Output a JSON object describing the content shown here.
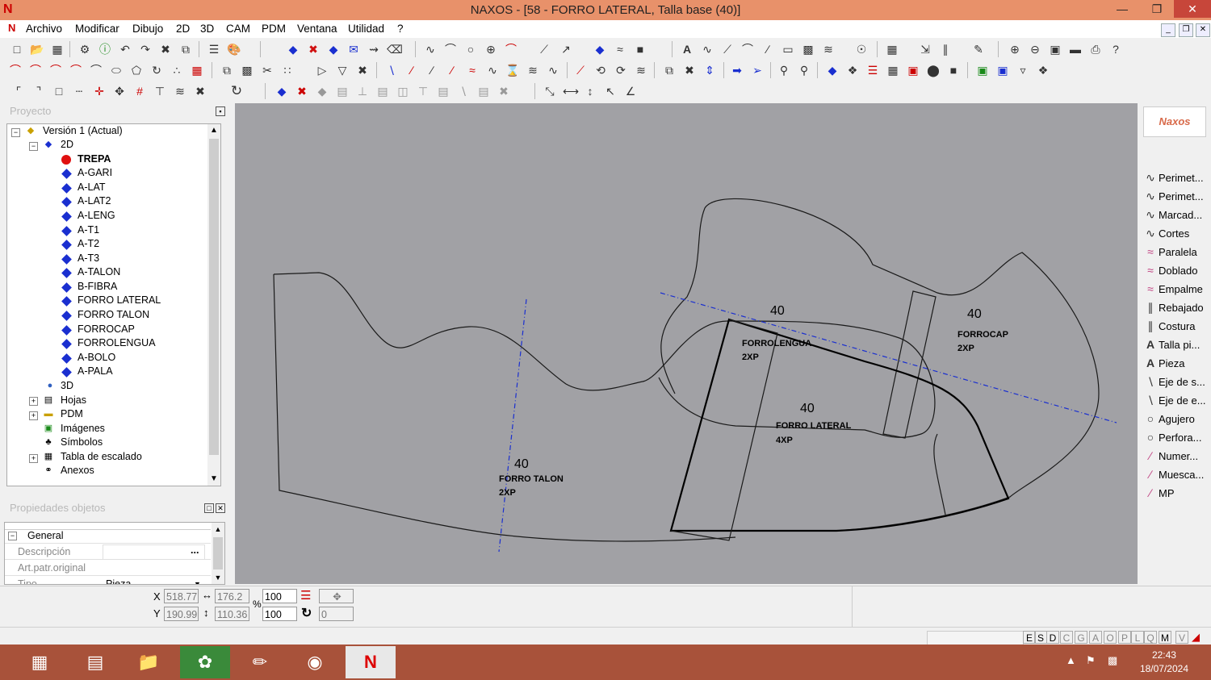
{
  "window": {
    "title": "NAXOS - [58 - FORRO LATERAL, Talla base (40)]",
    "app_icon": "naxos-logo-icon"
  },
  "menu": [
    "Archivo",
    "Modificar",
    "Dibujo",
    "2D",
    "3D",
    "CAM",
    "PDM",
    "Ventana",
    "Utilidad",
    "?"
  ],
  "project_panel": {
    "title": "Proyecto",
    "tree": {
      "root": "Versión 1 (Actual)",
      "group_2d": "2D",
      "pieces": [
        "TREPA",
        "A-GARI",
        "A-LAT",
        "A-LAT2",
        "A-LENG",
        "A-T1",
        "A-T2",
        "A-T3",
        "A-TALON",
        "B-FIBRA",
        "FORRO LATERAL",
        "FORRO TALON",
        "FORROCAP",
        "FORROLENGUA",
        "A-BOLO",
        "A-PALA"
      ],
      "others": [
        "3D",
        "Hojas",
        "PDM",
        "Imágenes",
        "Símbolos",
        "Tabla de escalado",
        "Anexos"
      ]
    }
  },
  "properties_panel": {
    "title": "Propiedades objetos",
    "section": "General",
    "rows": [
      {
        "label": "Descripción",
        "value": ""
      },
      {
        "label": "Art.patr.original",
        "value": ""
      },
      {
        "label": "Tipo",
        "value": "Pieza"
      }
    ],
    "ellipsis": "..."
  },
  "canvas": {
    "labels": [
      {
        "size": "40",
        "name": "FORRO TALON",
        "qty": "2XP"
      },
      {
        "size": "40",
        "name": "FORROLENGUA",
        "qty": "2XP"
      },
      {
        "size": "40",
        "name": "FORRO LATERAL",
        "qty": "4XP"
      },
      {
        "size": "40",
        "name": "FORROCAP",
        "qty": "2XP"
      }
    ]
  },
  "palette": {
    "logo": "Naxos",
    "items": [
      "Perimet...",
      "Perimet...",
      "Marcad...",
      "Cortes",
      "Paralela",
      "Doblado",
      "Empalme",
      "Rebajado",
      "Costura",
      "Talla pi...",
      "Pieza",
      "Eje de s...",
      "Eje de e...",
      "Agujero",
      "Perfora...",
      "Numer...",
      "Muesca...",
      "MP"
    ]
  },
  "coords": {
    "x_label": "X",
    "y_label": "Y",
    "x": "518.77",
    "y": "190.99",
    "width": "176.2",
    "height": "110.36",
    "scale_x": "100",
    "scale_y": "100",
    "percent": "%",
    "rotation": "0"
  },
  "status": {
    "toggles": [
      "E",
      "S",
      "D",
      "C",
      "G",
      "A",
      "O",
      "P",
      "L",
      "Q",
      "M",
      "V"
    ]
  },
  "taskbar": {
    "apps": [
      "calculator-icon",
      "explorer-icon",
      "folder-icon",
      "naxos-cad-icon",
      "pencil-app-icon",
      "chrome-icon",
      "naxos-active-icon"
    ],
    "time": "22:43",
    "date": "18/07/2024"
  }
}
